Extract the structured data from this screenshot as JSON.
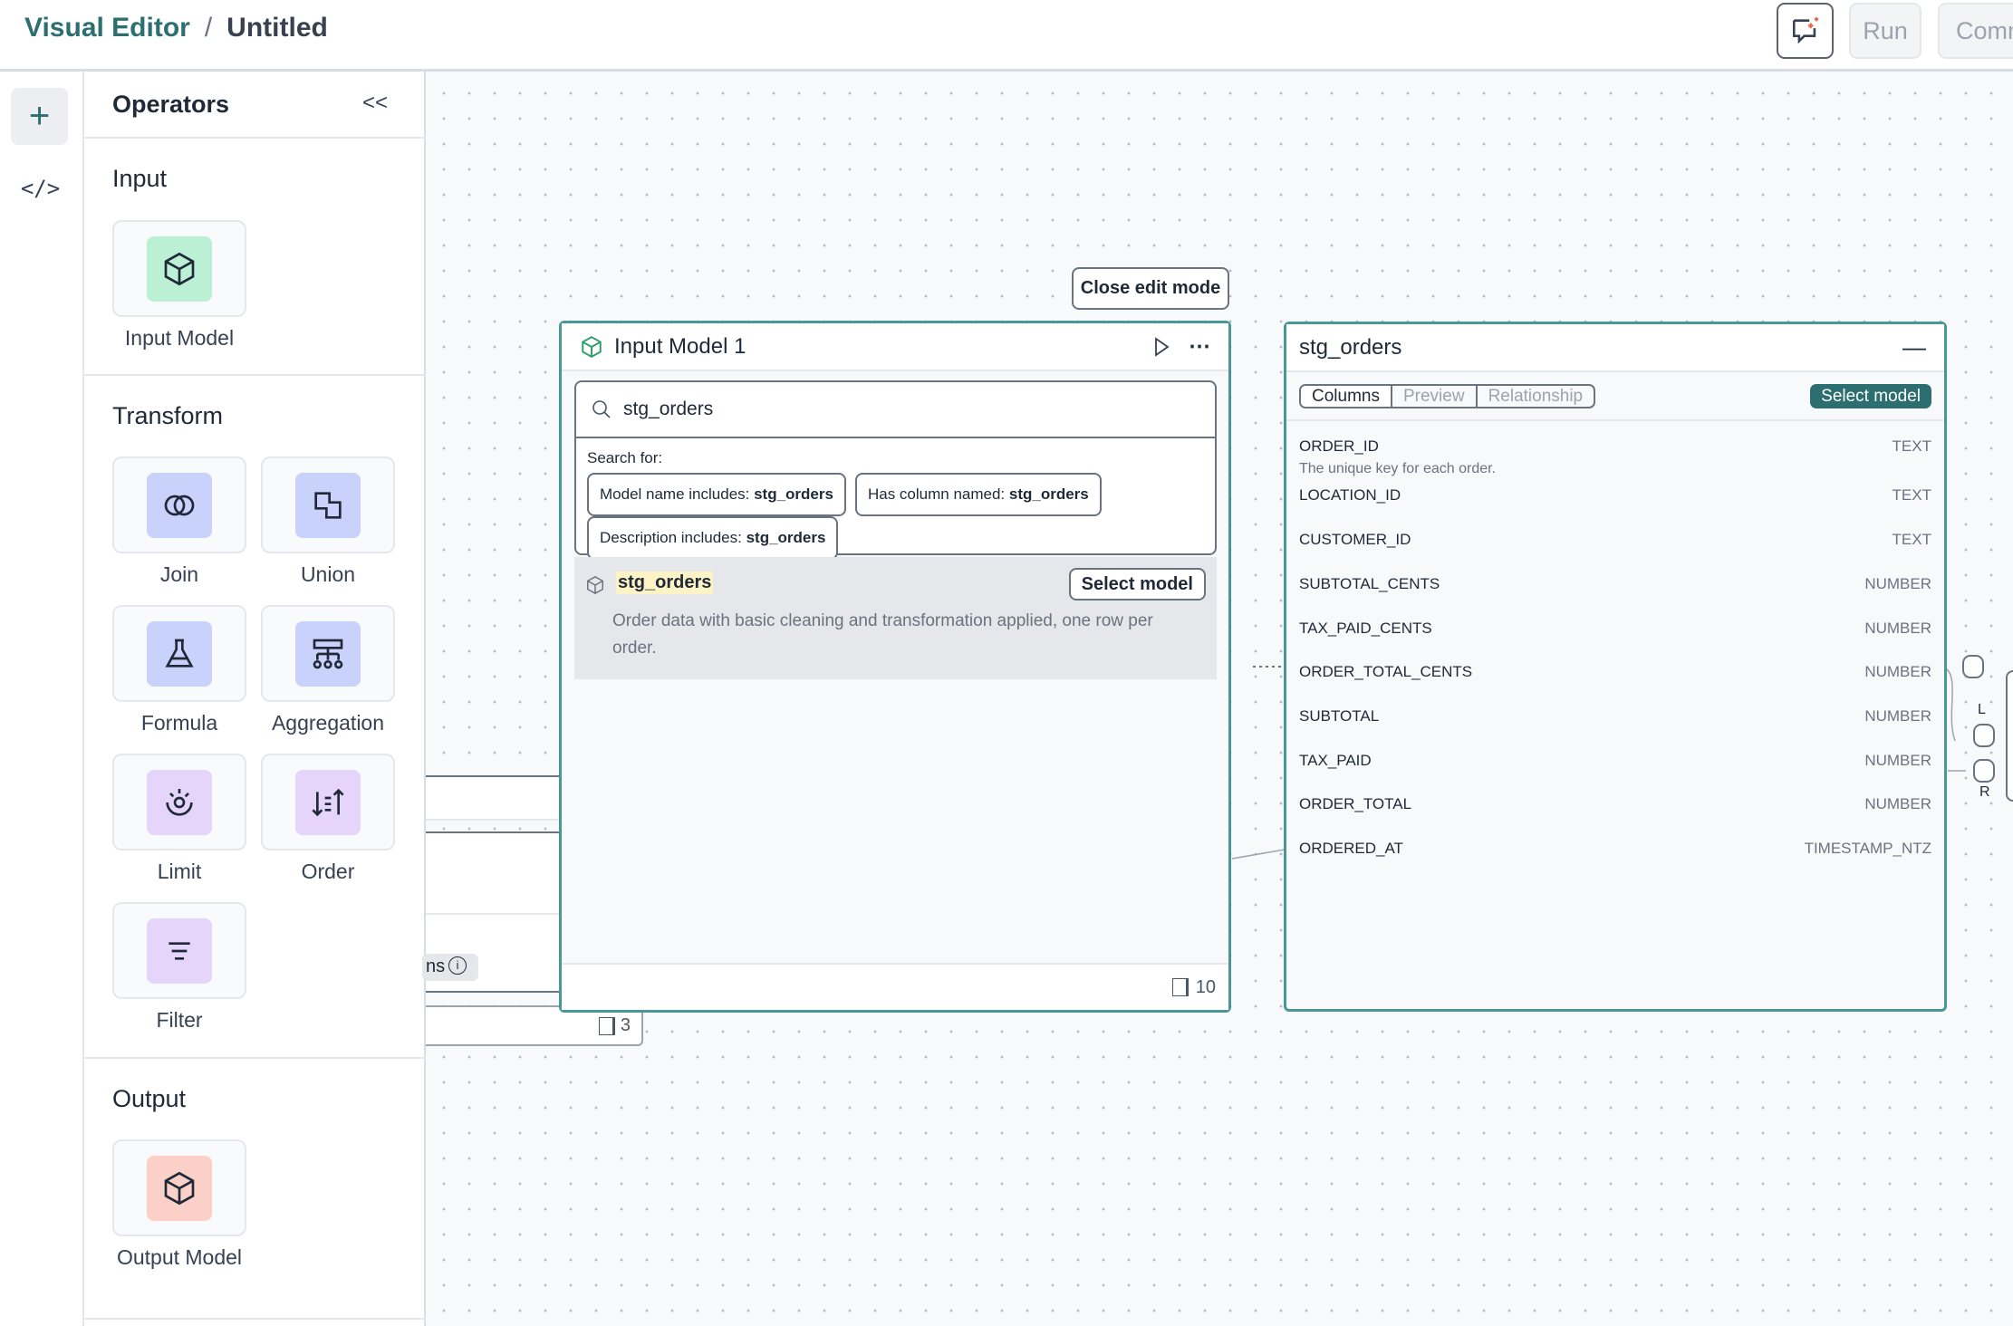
{
  "header": {
    "app": "Visual Editor",
    "separator": "/",
    "file": "Untitled",
    "run_label": "Run",
    "commit_label": "Comm"
  },
  "rail": {
    "add_icon": "plus-icon",
    "code_icon": "code-icon",
    "code_glyph": "</>"
  },
  "operators": {
    "title": "Operators",
    "collapse_glyph": "<<",
    "sections": {
      "input": {
        "title": "Input",
        "items": [
          {
            "label": "Input Model",
            "color": "#bbf0d5"
          }
        ]
      },
      "transform": {
        "title": "Transform",
        "items": [
          {
            "label": "Join",
            "color": "#c9d2fb"
          },
          {
            "label": "Union",
            "color": "#c9d2fb"
          },
          {
            "label": "Formula",
            "color": "#c9d2fb"
          },
          {
            "label": "Aggregation",
            "color": "#c9d2fb"
          },
          {
            "label": "Limit",
            "color": "#e5d5fb"
          },
          {
            "label": "Order",
            "color": "#e5d5fb"
          },
          {
            "label": "Filter",
            "color": "#e5d5fb"
          }
        ]
      },
      "output": {
        "title": "Output",
        "items": [
          {
            "label": "Output Model",
            "color": "#fbd0c8"
          }
        ]
      }
    }
  },
  "canvas": {
    "partial_node": {
      "info_text": "ns",
      "columns_count": "3"
    },
    "close_edit_label": "Close edit mode",
    "input_node": {
      "title": "Input Model 1",
      "search_value": "stg_orders",
      "search_for_label": "Search for:",
      "chips": [
        {
          "prefix": "Model name includes: ",
          "value": "stg_orders"
        },
        {
          "prefix": "Has column named: ",
          "value": "stg_orders"
        },
        {
          "prefix": "Description includes: ",
          "value": "stg_orders"
        }
      ],
      "result": {
        "name": "stg_orders",
        "select_label": "Select model",
        "description": "Order data with basic cleaning and transformation applied, one row per order."
      },
      "columns_count": "10"
    },
    "model_node": {
      "title": "stg_orders",
      "tabs": [
        "Columns",
        "Preview",
        "Relationship"
      ],
      "active_tab": "Columns",
      "select_label": "Select model",
      "columns": [
        {
          "name": "ORDER_ID",
          "type": "TEXT",
          "description": "The unique key for each order."
        },
        {
          "name": "LOCATION_ID",
          "type": "TEXT"
        },
        {
          "name": "CUSTOMER_ID",
          "type": "TEXT"
        },
        {
          "name": "SUBTOTAL_CENTS",
          "type": "NUMBER"
        },
        {
          "name": "TAX_PAID_CENTS",
          "type": "NUMBER"
        },
        {
          "name": "ORDER_TOTAL_CENTS",
          "type": "NUMBER"
        },
        {
          "name": "SUBTOTAL",
          "type": "NUMBER"
        },
        {
          "name": "TAX_PAID",
          "type": "NUMBER"
        },
        {
          "name": "ORDER_TOTAL",
          "type": "NUMBER"
        },
        {
          "name": "ORDERED_AT",
          "type": "TIMESTAMP_NTZ"
        }
      ]
    },
    "join_handles": {
      "left": "L",
      "right": "R"
    }
  },
  "colors": {
    "accent": "#2d6f70",
    "node_border": "#4a9896",
    "highlight": "#fdf3c4",
    "ai_spark": "#e8674a"
  }
}
